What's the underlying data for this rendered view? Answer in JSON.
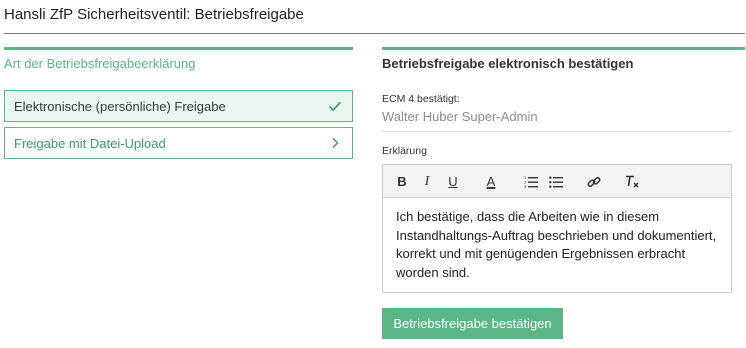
{
  "page": {
    "title": "Hansli ZfP Sicherheitsventil: Betriebsfreigabe"
  },
  "left": {
    "heading": "Art der Betriebsfreigabeerklärung",
    "options": [
      {
        "label": "Elektronische (persönliche) Freigabe",
        "icon": "check-icon",
        "selected": true
      },
      {
        "label": "Freigabe mit Datei-Upload",
        "icon": "chevron-right-icon",
        "selected": false
      }
    ]
  },
  "right": {
    "heading": "Betriebsfreigabe elektronisch bestätigen",
    "ecm_label": "ECM 4 bestätigt:",
    "ecm_value": "Walter Huber Super-Admin",
    "erklaerung_label": "Erklärung",
    "toolbar": {
      "bold": "B",
      "italic": "I",
      "underline": "U",
      "font_color": "A",
      "items": [
        "bold-icon",
        "italic-icon",
        "underline-icon",
        "font-color-icon",
        "ordered-list-icon",
        "bullet-list-icon",
        "link-icon",
        "clear-format-icon"
      ]
    },
    "editor_text": "Ich bestätige, dass die Arbeiten wie in diesem Instandhaltungs-Auftrag beschrieben und dokumentiert, korrekt und mit genügenden Ergebnissen erbracht worden sind.",
    "confirm_button": "Betriebsfreigabe bestätigen"
  },
  "colors": {
    "accent": "#5cb585",
    "selected_bg": "#eaf6ef",
    "toolbar_bg": "#f3f3f3"
  }
}
